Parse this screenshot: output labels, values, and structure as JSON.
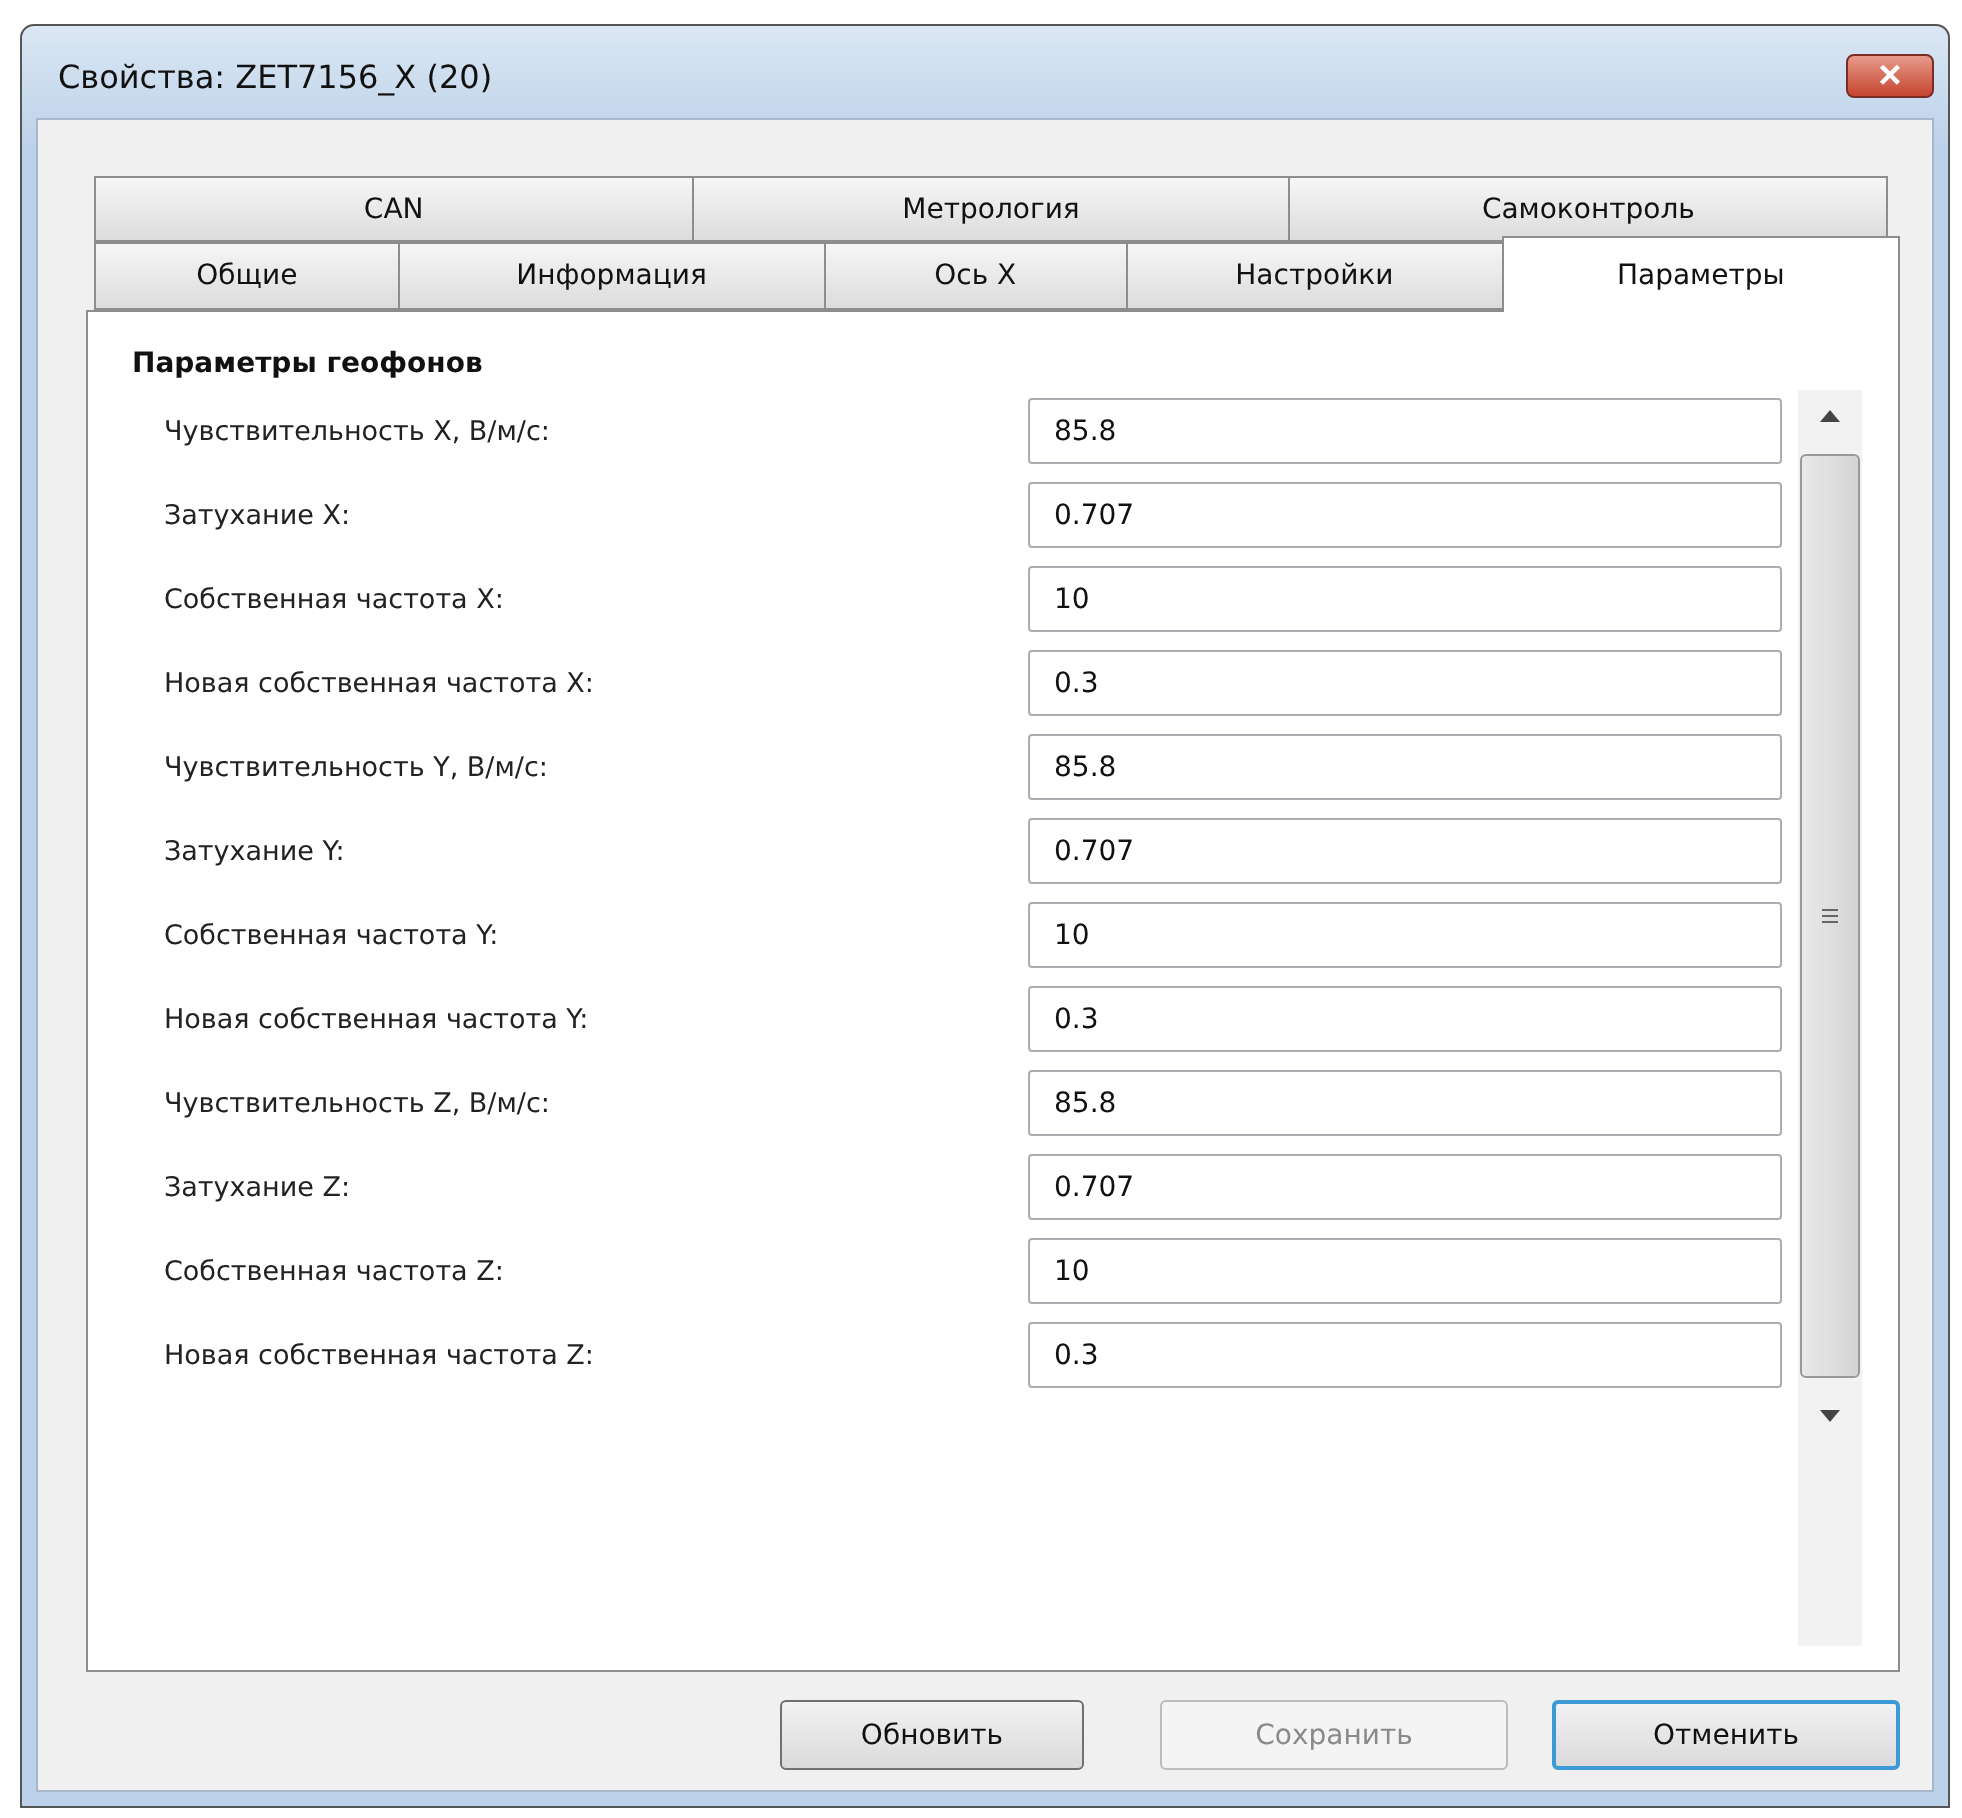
{
  "window": {
    "title": "Свойства: ZET7156_X (20)",
    "close": "×"
  },
  "tab_rows": [
    {
      "tabs": [
        {
          "label": "CAN",
          "selected": false
        },
        {
          "label": "Метрология",
          "selected": false
        },
        {
          "label": "Самоконтроль",
          "selected": false
        }
      ]
    },
    {
      "tabs": [
        {
          "label": "Общие",
          "selected": false
        },
        {
          "label": "Информация",
          "selected": false
        },
        {
          "label": "Ось X",
          "selected": false
        },
        {
          "label": "Настройки",
          "selected": false
        },
        {
          "label": "Параметры",
          "selected": true
        }
      ]
    }
  ],
  "group": {
    "title": "Параметры геофонов",
    "fields": [
      {
        "label": "Чувствительность X, В/м/с:",
        "value": "85.8"
      },
      {
        "label": "Затухание X:",
        "value": "0.707"
      },
      {
        "label": "Собственная частота X:",
        "value": "10"
      },
      {
        "label": "Новая собственная частота X:",
        "value": "0.3"
      },
      {
        "label": "Чувствительность Y, В/м/с:",
        "value": "85.8"
      },
      {
        "label": "Затухание Y:",
        "value": "0.707"
      },
      {
        "label": "Собственная частота Y:",
        "value": "10"
      },
      {
        "label": "Новая собственная частота Y:",
        "value": "0.3"
      },
      {
        "label": "Чувствительность Z, В/м/с:",
        "value": "85.8"
      },
      {
        "label": "Затухание Z:",
        "value": "0.707"
      },
      {
        "label": "Собственная частота Z:",
        "value": "10"
      },
      {
        "label": "Новая собственная частота Z:",
        "value": "0.3"
      }
    ]
  },
  "buttons": [
    {
      "label": "Обновить",
      "disabled": false,
      "default": false
    },
    {
      "label": "Сохранить",
      "disabled": true,
      "default": false
    },
    {
      "label": "Отменить",
      "disabled": false,
      "default": true
    }
  ]
}
